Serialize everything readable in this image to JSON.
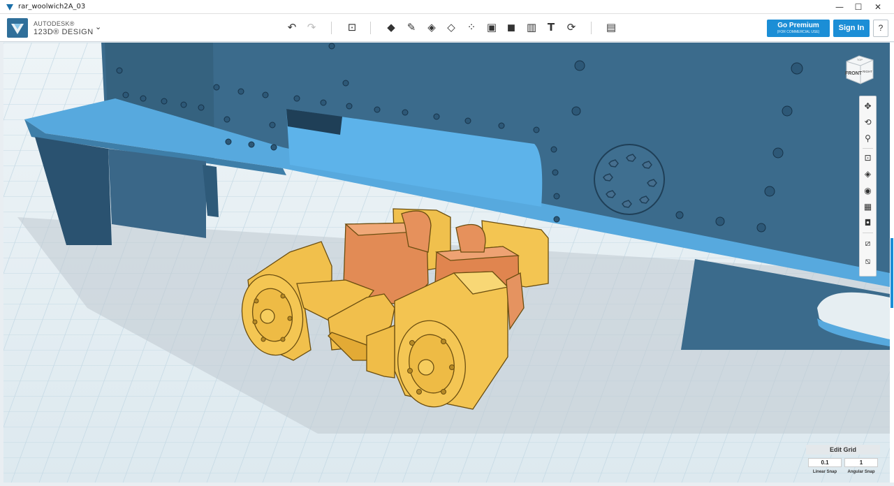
{
  "window": {
    "title": "rar_woolwich2A_03",
    "minimize": "—",
    "maximize": "☐",
    "close": "✕"
  },
  "logo": {
    "line1": "AUTODESK®",
    "line2": "123D® DESIGN"
  },
  "toolbar": {
    "tools": [
      "undo-icon",
      "redo-icon",
      "transform-icon",
      "primitives-icon",
      "sketch-icon",
      "construct-icon",
      "modify-icon",
      "pattern-icon",
      "group-icon",
      "combine-icon",
      "measure-icon",
      "text-icon",
      "snap-icon",
      "material-icon"
    ],
    "premium_label": "Go Premium",
    "premium_sub": "(FOR COMMERCIAL USE)",
    "signin_label": "Sign In",
    "help_label": "?"
  },
  "viewcube": {
    "front": "FRONT",
    "right": "RIGHT",
    "top": "TOP"
  },
  "navbar": {
    "tools": [
      "pan-icon",
      "orbit-icon",
      "zoom-icon",
      "fit-icon",
      "views-icon",
      "visibility-icon",
      "material-display-icon",
      "screenshot-icon",
      "show-sketches-icon",
      "hide-sketches-icon"
    ]
  },
  "edit_grid": {
    "title": "Edit Grid",
    "linear_value": "0.1",
    "angular_value": "1",
    "linear_label": "Linear Snap",
    "angular_label": "Angular Snap"
  },
  "colors": {
    "accent": "#1b8ed6",
    "frame_blue": "#3d6d8e",
    "frame_light": "#5aafe6",
    "gold": "#f2c14e",
    "copper": "#e08a55",
    "grid_bg": "#dbe8ee"
  }
}
